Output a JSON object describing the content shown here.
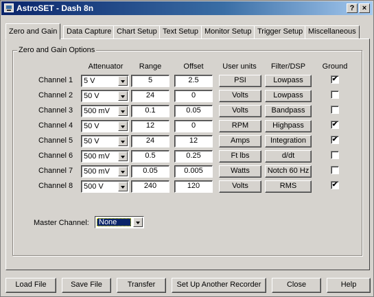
{
  "window": {
    "title": "AstroSET - Dash 8n",
    "help_label": "?",
    "close_label": "×"
  },
  "tabs": [
    {
      "label": "Zero and Gain"
    },
    {
      "label": "Data Capture"
    },
    {
      "label": "Chart Setup"
    },
    {
      "label": "Text Setup"
    },
    {
      "label": "Monitor Setup"
    },
    {
      "label": "Trigger Setup"
    },
    {
      "label": "Miscellaneous"
    }
  ],
  "group_title": "Zero and Gain Options",
  "headers": {
    "attenuator": "Attenuator",
    "range": "Range",
    "offset": "Offset",
    "units": "User units",
    "filter": "Filter/DSP",
    "ground": "Ground"
  },
  "channels": [
    {
      "label": "Channel 1",
      "attenuator": "5 V",
      "range": "5",
      "offset": "2.5",
      "units": "PSI",
      "filter": "Lowpass",
      "ground": "✔"
    },
    {
      "label": "Channel 2",
      "attenuator": "50 V",
      "range": "24",
      "offset": "0",
      "units": "Volts",
      "filter": "Lowpass",
      "ground": ""
    },
    {
      "label": "Channel 3",
      "attenuator": "500 mV",
      "range": "0.1",
      "offset": "0.05",
      "units": "Volts",
      "filter": "Bandpass",
      "ground": ""
    },
    {
      "label": "Channel 4",
      "attenuator": "50 V",
      "range": "12",
      "offset": "0",
      "units": "RPM",
      "filter": "Highpass",
      "ground": "✔"
    },
    {
      "label": "Channel 5",
      "attenuator": "50 V",
      "range": "24",
      "offset": "12",
      "units": "Amps",
      "filter": "Integration",
      "ground": "✔"
    },
    {
      "label": "Channel 6",
      "attenuator": "500 mV",
      "range": "0.5",
      "offset": "0.25",
      "units": "Ft lbs",
      "filter": "d/dt",
      "ground": ""
    },
    {
      "label": "Channel 7",
      "attenuator": "500 mV",
      "range": "0.05",
      "offset": "0.005",
      "units": "Watts",
      "filter": "Notch 60 Hz",
      "ground": ""
    },
    {
      "label": "Channel 8",
      "attenuator": "500 V",
      "range": "240",
      "offset": "120",
      "units": "Volts",
      "filter": "RMS",
      "ground": "✔"
    }
  ],
  "master": {
    "label": "Master Channel:",
    "value": "None"
  },
  "footer": {
    "load": "Load File",
    "save": "Save File",
    "transfer": "Transfer",
    "setup_another": "Set Up Another Recorder",
    "close": "Close",
    "help": "Help"
  }
}
